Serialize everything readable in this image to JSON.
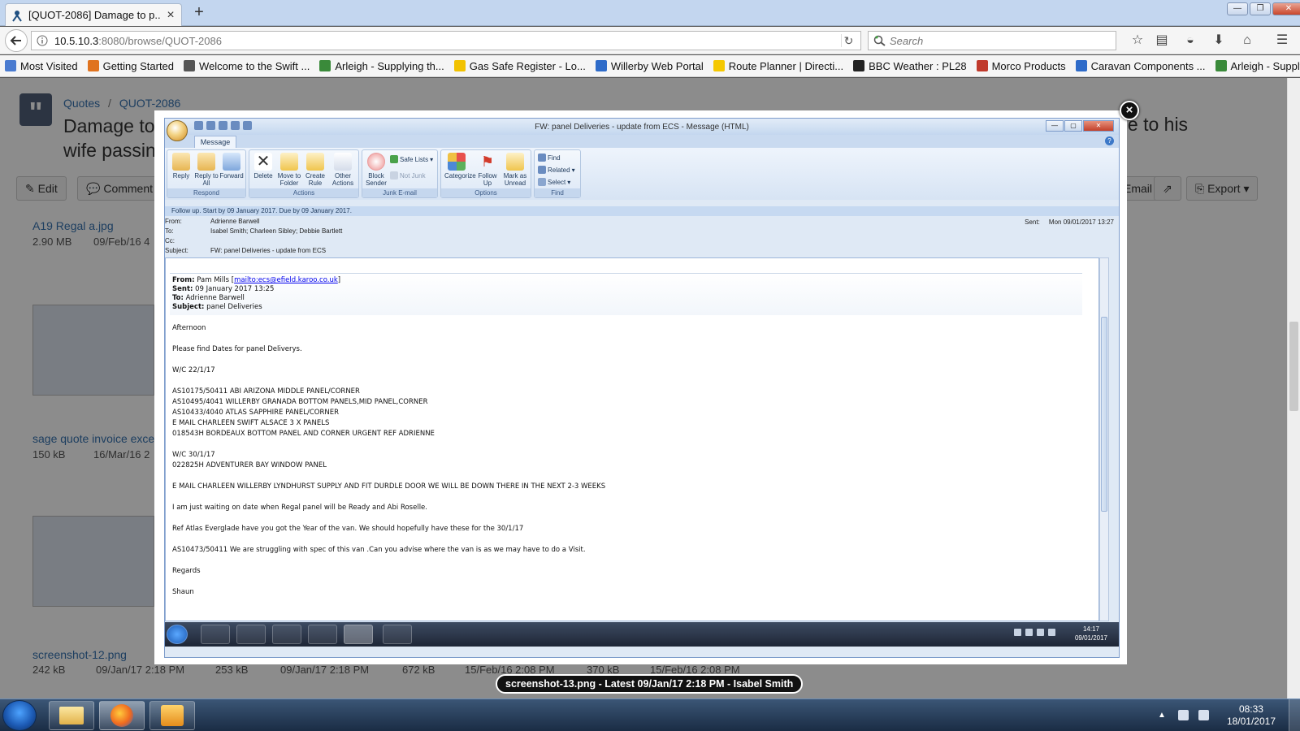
{
  "browser": {
    "tab_title": "[QUOT-2086] Damage to p...",
    "url_host": "10.5.10.3",
    "url_path": ":8080/browse/QUOT-2086",
    "search_placeholder": "Search",
    "bookmarks": [
      {
        "label": "Most Visited",
        "icon": "page-icon",
        "color": "#4a7bd0"
      },
      {
        "label": "Getting Started",
        "icon": "firefox-icon",
        "color": "#e0731f"
      },
      {
        "label": "Welcome to the Swift ...",
        "icon": "globe-icon",
        "color": "#555555"
      },
      {
        "label": "Arleigh - Supplying th...",
        "icon": "arleigh-icon",
        "color": "#3a8a3a"
      },
      {
        "label": "Gas Safe Register - Lo...",
        "icon": "gassafe-icon",
        "color": "#f2c200"
      },
      {
        "label": "Willerby Web Portal",
        "icon": "willerby-icon",
        "color": "#2e6bc9"
      },
      {
        "label": "Route Planner | Directi...",
        "icon": "aa-icon",
        "color": "#f5c800"
      },
      {
        "label": "BBC Weather : PL28",
        "icon": "bbc-icon",
        "color": "#222222"
      },
      {
        "label": "Morco Products",
        "icon": "morco-icon",
        "color": "#c0392b"
      },
      {
        "label": "Caravan Components ...",
        "icon": "cc-icon",
        "color": "#2e6bc9"
      },
      {
        "label": "Arleigh - Supplying th...",
        "icon": "arleigh-icon",
        "color": "#3a8a3a"
      }
    ]
  },
  "background_page": {
    "breadcrumb_project": "Quotes",
    "breadcrumb_sep": "/",
    "breadcrumb_issue": "QUOT-2086",
    "title_left": "Damage to wife passin",
    "title_right": "lue to his",
    "buttons": {
      "edit": "Edit",
      "comment": "Comment",
      "email": "Email",
      "export": "Export"
    },
    "files": [
      {
        "name": "A19 Regal a.jpg",
        "size": "2.90 MB",
        "date": "09/Feb/16 4"
      },
      {
        "name": "sage quote invoice exce",
        "size": "150 kB",
        "date": "16/Mar/16 2"
      },
      {
        "name": "screenshot-12.png",
        "size": "242 kB",
        "date": "09/Jan/17 2:18 PM"
      }
    ],
    "partial_meta": [
      "253 kB",
      "09/Jan/17 2:18 PM",
      "672 kB",
      "15/Feb/16 2:08 PM",
      "370 kB",
      "15/Feb/16 2:08 PM"
    ]
  },
  "lightbox": {
    "close_label": "×",
    "caption": "screenshot-13.png - Latest 09/Jan/17 2:18 PM - Isabel Smith"
  },
  "outlook": {
    "window_title": "FW: panel Deliveries - update from ECS - Message (HTML)",
    "tab_message": "Message",
    "ribbon": {
      "respond": {
        "label": "Respond",
        "buttons": [
          "Reply",
          "Reply to All",
          "Forward"
        ]
      },
      "actions": {
        "label": "Actions",
        "buttons": [
          "Delete",
          "Move to Folder",
          "Create Rule",
          "Other Actions"
        ]
      },
      "junk": {
        "label": "Junk E-mail",
        "block_sender": "Block Sender",
        "safe_lists": "Safe Lists",
        "not_junk": "Not Junk"
      },
      "options": {
        "label": "Options",
        "buttons": [
          "Categorize",
          "Follow Up",
          "Mark as Unread"
        ]
      },
      "find": {
        "label": "Find",
        "items": [
          "Find",
          "Related",
          "Select"
        ]
      }
    },
    "follow_up": "Follow up.  Start by 09 January 2017.  Due by 09 January 2017.",
    "header": {
      "from_label": "From:",
      "from": "Adrienne Barwell",
      "to_label": "To:",
      "to": "Isabel Smith; Charleen Sibley; Debbie Bartlett",
      "cc_label": "Cc:",
      "cc": "",
      "subject_label": "Subject:",
      "subject": "FW: panel Deliveries - update from ECS",
      "sent_label": "Sent:",
      "sent": "Mon 09/01/2017 13:27"
    },
    "forwarded": {
      "from_label": "From:",
      "from_name": "Pam Mills",
      "from_link": "mailto:ecs@efield.karoo.co.uk",
      "sent_label": "Sent:",
      "sent": "09 January 2017 13:25",
      "to_label": "To:",
      "to": "Adrienne Barwell",
      "subject_label": "Subject:",
      "subject": "panel Deliveries"
    },
    "body_lines": [
      "Afternoon",
      "Please find Dates for panel Deliverys.",
      "W/C 22/1/17",
      "AS10175/50411 ABI ARIZONA MIDDLE PANEL/CORNER",
      "AS10495/4041  WILLERBY GRANADA BOTTOM PANELS,MID PANEL,CORNER",
      "AS10433/4040 ATLAS SAPPHIRE PANEL/CORNER",
      "E MAIL CHARLEEN SWIFT ALSACE 3 X PANELS",
      "018543H BORDEAUX BOTTOM PANEL AND CORNER URGENT REF ADRIENNE",
      "W/C 30/1/17",
      "022825H ADVENTURER BAY WINDOW PANEL",
      "E MAIL CHARLEEN WILLERBY LYNDHURST SUPPLY AND FIT DURDLE DOOR WE WILL BE DOWN THERE IN THE NEXT 2-3 WEEKS",
      "I am just waiting on date when Regal panel will be Ready and Abi Roselle.",
      "Ref Atlas Everglade have you got the Year of the van. We should hopefully have these for the 30/1/17",
      "AS10473/50411 We are struggling with spec of this van .Can you advise where the van is as we may have to do a Visit.",
      "Regards",
      "Shaun"
    ],
    "taskbar_time": "14:17",
    "taskbar_date": "09/01/2017"
  },
  "system": {
    "clock_time": "08:33",
    "clock_date": "18/01/2017"
  }
}
